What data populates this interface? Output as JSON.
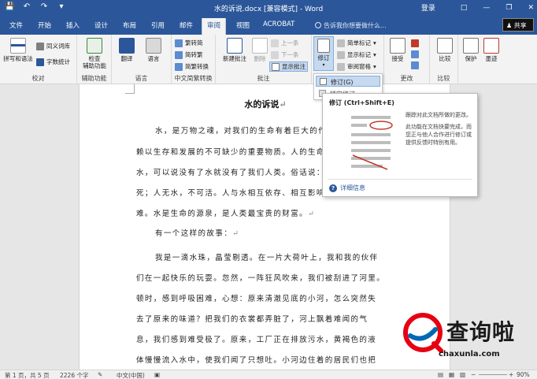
{
  "titlebar": {
    "document_title": "水的诉说.docx [兼容模式] - Word",
    "sign_in": "登录",
    "window_controls": [
      "minimize-icon",
      "restore-icon",
      "close-icon"
    ]
  },
  "tabs": [
    "文件",
    "开始",
    "插入",
    "设计",
    "布局",
    "引用",
    "邮件",
    "审阅",
    "视图",
    "ACROBAT"
  ],
  "active_tab": "审阅",
  "tellme": "告诉我你想要做什么...",
  "share": "共享",
  "ribbon": {
    "groups": {
      "proofing": {
        "label": "校对",
        "spelling": "拼写和语法",
        "thesaurus": "同义词库",
        "word_count": "字数统计"
      },
      "accessibility": {
        "label": "辅助功能",
        "check": "检查\n辅助功能"
      },
      "language": {
        "label": "语言",
        "translate": "翻译",
        "language": "语言"
      },
      "chinese": {
        "label": "中文简繁转换",
        "to_simplified": "繁转简",
        "to_traditional": "简转繁",
        "convert": "简繁转换"
      },
      "comments": {
        "label": "批注",
        "new": "新建批注",
        "delete": "删除",
        "previous": "上一条",
        "next": "下一条",
        "show": "显示批注"
      },
      "tracking": {
        "label": "修订",
        "track": "修订",
        "simple_markup": "简单标记",
        "show_markup": "显示标记",
        "reviewing_pane": "审阅窗格"
      },
      "changes": {
        "label": "更改",
        "accept": "接受"
      },
      "compare": {
        "label": "比较",
        "compare": "比较"
      },
      "protect": {
        "protect": "保护",
        "ink": "墨迹"
      }
    }
  },
  "dropdown": {
    "item1": "修订(G)",
    "item2": "锁定修订"
  },
  "tooltip": {
    "title": "修订 (Ctrl+Shift+E)",
    "desc1": "跟踪对此文档所做的更改。",
    "desc2": "此功能在文档快要完成，而您正与他人合作进行修订或提供反馈时特别有用。",
    "more_info": "详细信息"
  },
  "document": {
    "title": "水的诉说",
    "lines": [
      "水，是万物之魂，对我们的生命有着巨大的作用",
      "赖以生存和发展的不可缺少的重要物质。人的生命一",
      "水，可以说没有了水就没有了我们人类。俗话说：人",
      "死；人无水，不可活。人与水相互依存、相互影响，",
      "难。水是生命的源泉，是人类最宝贵的财富。",
      "有一个这样的故事：",
      "我是一滴水珠，晶莹剔透。在一片大荷叶上，我和我的伙伴",
      "们在一起快乐的玩耍。忽然，一阵狂风吹来，我们被刮进了河里。",
      "顿时，感到呼吸困难，心想：原来清澈见底的小河，怎么突然失",
      "去了原来的味道？把我们的衣裳都弄脏了，河上飘着难闻的气",
      "息，我们感到难受极了。原来，工厂正在排放污水，黄褐色的液",
      "体慢慢流入水中，使我们闻了只想吐。小河边住着的居民们也把"
    ]
  },
  "statusbar": {
    "page": "第 1 页，共 5 页",
    "words": "2226 个字",
    "language": "中文(中国)",
    "zoom": "90%"
  },
  "watermark": {
    "brand": "查询啦",
    "url": "chaxunla.com"
  },
  "colors": {
    "word_blue": "#2b579a",
    "ribbon_bg": "#f3f3f3",
    "highlight": "#c5d9ef",
    "watermark_red": "#e60012",
    "watermark_blue": "#0068b7"
  }
}
